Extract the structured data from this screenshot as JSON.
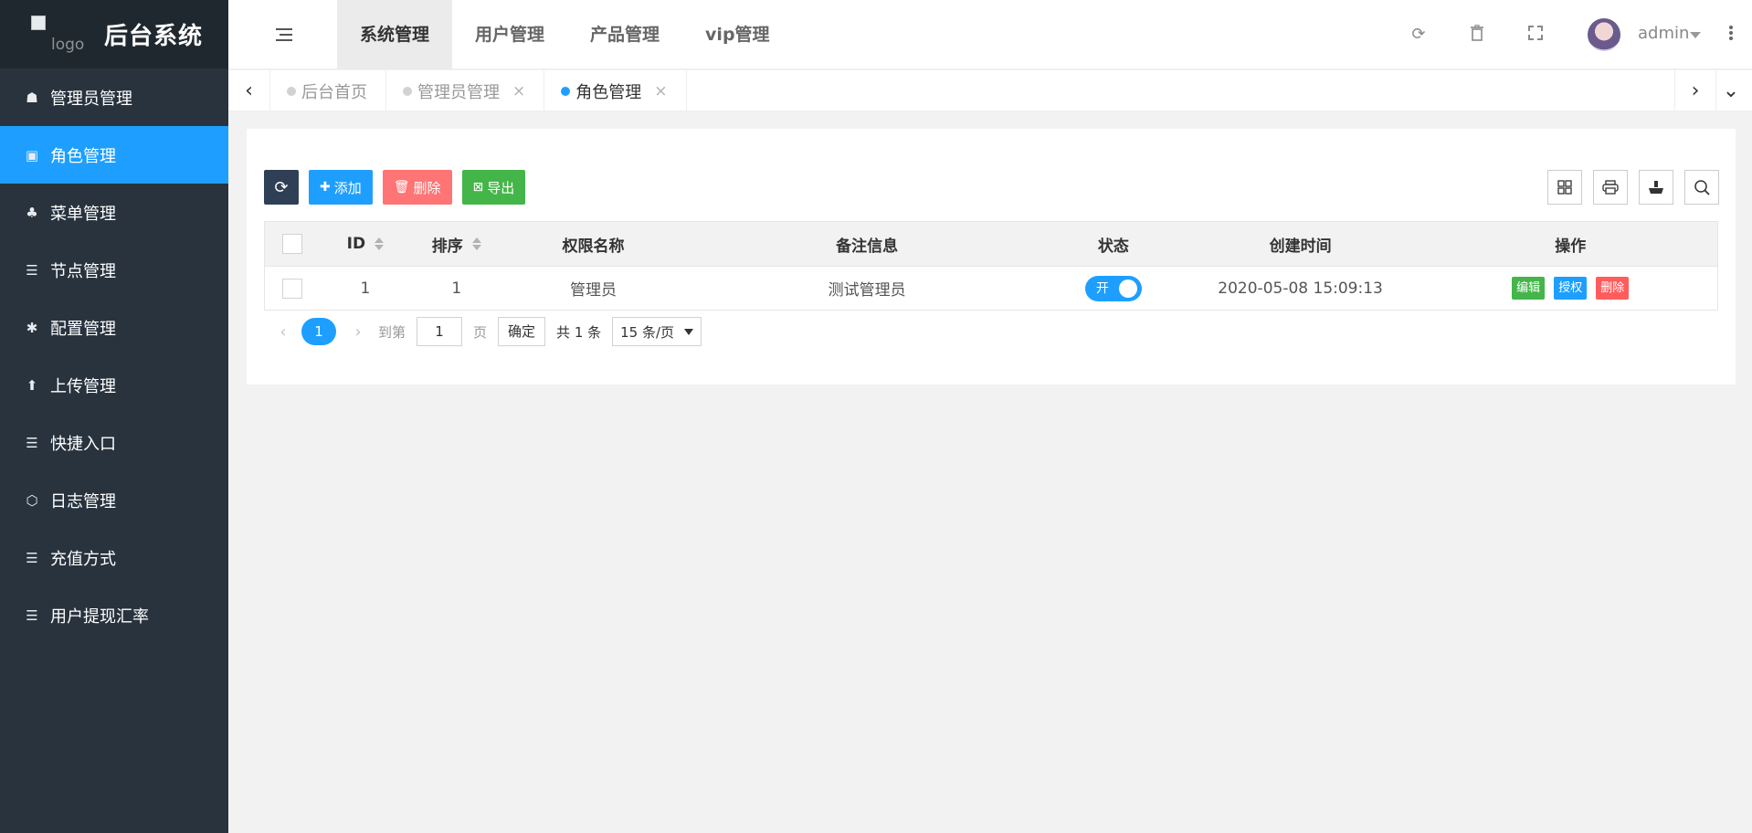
{
  "sidebar": {
    "logo_alt": "logo",
    "title": "后台系统",
    "items": [
      {
        "label": "管理员管理",
        "icon": "user-icon",
        "glyph": "☗"
      },
      {
        "label": "角色管理",
        "icon": "badge-icon",
        "glyph": "▣"
      },
      {
        "label": "菜单管理",
        "icon": "tree-icon",
        "glyph": "♣"
      },
      {
        "label": "节点管理",
        "icon": "list-icon",
        "glyph": "☰"
      },
      {
        "label": "配置管理",
        "icon": "asterisk-icon",
        "glyph": "✱"
      },
      {
        "label": "上传管理",
        "icon": "upload-arrow-icon",
        "glyph": "⬆"
      },
      {
        "label": "快捷入口",
        "icon": "list-icon",
        "glyph": "☰"
      },
      {
        "label": "日志管理",
        "icon": "hexagon-icon",
        "glyph": "⬡"
      },
      {
        "label": "充值方式",
        "icon": "list-icon",
        "glyph": "☰"
      },
      {
        "label": "用户提现汇率",
        "icon": "list-icon",
        "glyph": "☰"
      }
    ]
  },
  "header": {
    "tabs": [
      "系统管理",
      "用户管理",
      "产品管理",
      "vip管理"
    ],
    "user_name": "admin"
  },
  "page_tabs": {
    "items": [
      {
        "label": "后台首页",
        "closable": false
      },
      {
        "label": "管理员管理",
        "closable": true
      },
      {
        "label": "角色管理",
        "closable": true
      }
    ],
    "close_glyph": "×"
  },
  "toolbar": {
    "refresh_glyph": "⟳",
    "add_label": "添加",
    "delete_label": "删除",
    "export_label": "导出"
  },
  "table": {
    "columns": {
      "id": "ID",
      "sort": "排序",
      "name": "权限名称",
      "remark": "备注信息",
      "status": "状态",
      "created": "创建时间",
      "ops": "操作"
    },
    "rows": [
      {
        "id": "1",
        "sort": "1",
        "name": "管理员",
        "remark": "测试管理员",
        "status_label": "开",
        "created": "2020-05-08 15:09:13",
        "ops": {
          "edit": "编辑",
          "auth": "授权",
          "delete": "删除"
        }
      }
    ]
  },
  "pager": {
    "current": "1",
    "goto_label": "到第",
    "goto_value": "1",
    "page_label": "页",
    "confirm_label": "确定",
    "total_label": "共 1 条",
    "page_size": "15 条/页"
  },
  "colors": {
    "sidebar_bg": "#28333e",
    "accent": "#1e9fff",
    "success": "#44b549",
    "danger": "#ff5c5c"
  }
}
